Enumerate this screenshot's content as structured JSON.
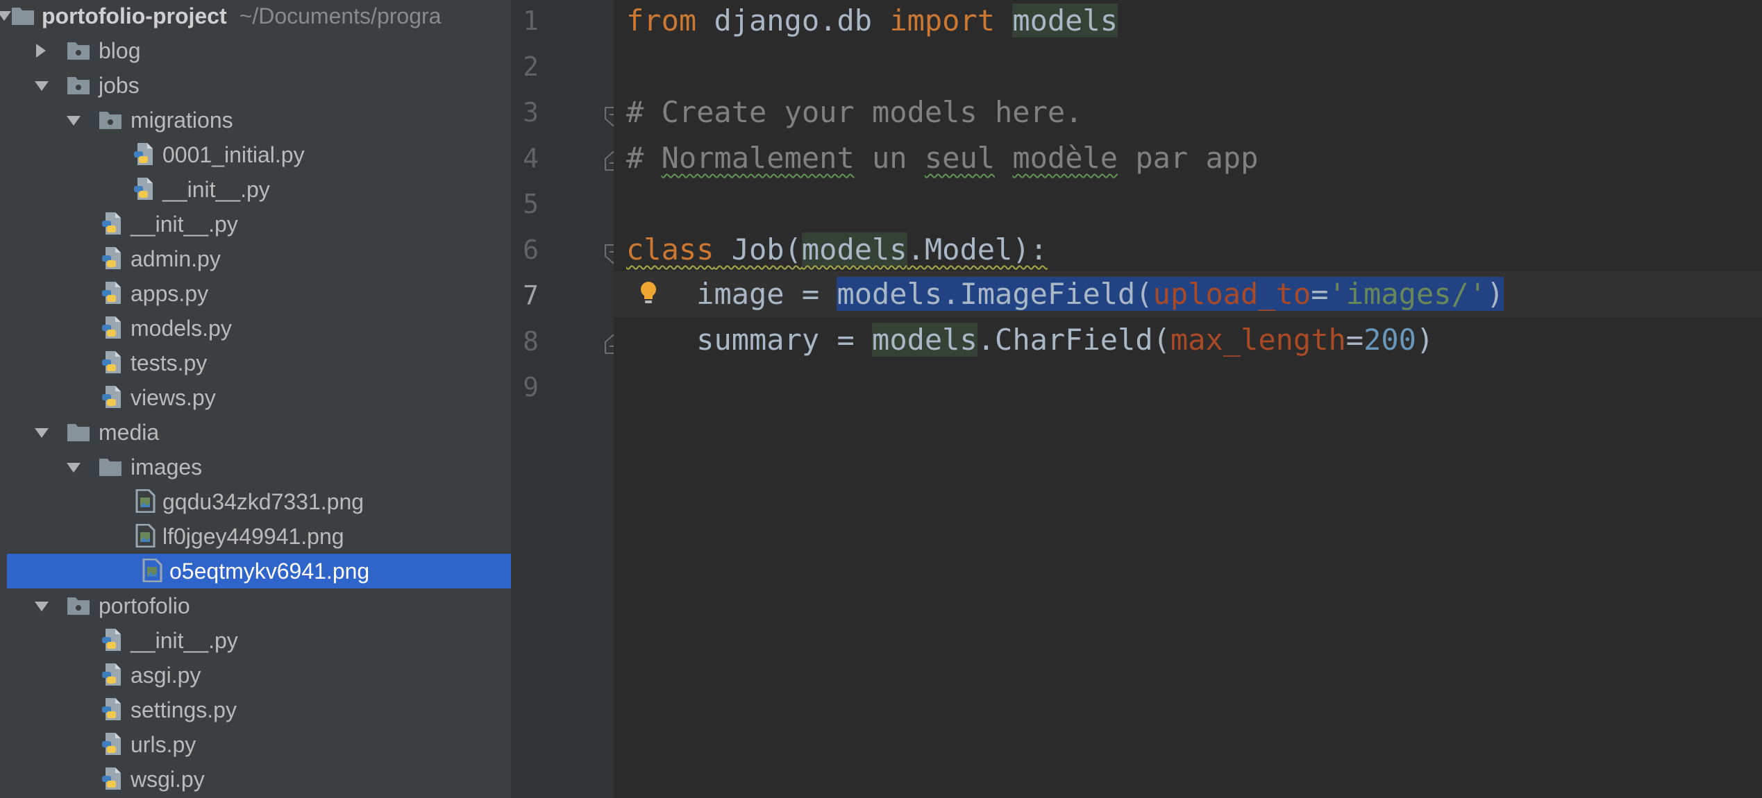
{
  "project_tree": {
    "root": {
      "name": "portofolio-project",
      "path": "~/Documents/progra"
    },
    "items": [
      {
        "label": "blog"
      },
      {
        "label": "jobs"
      },
      {
        "label": "migrations"
      },
      {
        "label": "0001_initial.py"
      },
      {
        "label": "__init__.py"
      },
      {
        "label": "__init__.py"
      },
      {
        "label": "admin.py"
      },
      {
        "label": "apps.py"
      },
      {
        "label": "models.py"
      },
      {
        "label": "tests.py"
      },
      {
        "label": "views.py"
      },
      {
        "label": "media"
      },
      {
        "label": "images"
      },
      {
        "label": "gqdu34zkd7331.png"
      },
      {
        "label": "lf0jgey449941.png"
      },
      {
        "label": "o5eqtmykv6941.png"
      },
      {
        "label": "portofolio"
      },
      {
        "label": "__init__.py"
      },
      {
        "label": "asgi.py"
      },
      {
        "label": "settings.py"
      },
      {
        "label": "urls.py"
      },
      {
        "label": "wsgi.py"
      }
    ],
    "selected_item": "o5eqtmykv6941.png"
  },
  "gutter": {
    "line_numbers": [
      "1",
      "2",
      "3",
      "4",
      "5",
      "6",
      "7",
      "8",
      "9"
    ],
    "current_line": "7"
  },
  "editor": {
    "line1": {
      "kw_from": "from",
      "module": " django.db ",
      "kw_import": "import",
      "sp": " ",
      "name": "models"
    },
    "line3": {
      "comment": "# Create your models here."
    },
    "line4": {
      "hash": "# ",
      "w1": "Normalement",
      "s1": " un ",
      "w2": "seul",
      "s2": " ",
      "w3": "modèle",
      "s3": " par app"
    },
    "line6": {
      "kw_class": "class",
      "s1": " Job(",
      "models": "models",
      "rest": ".Model):"
    },
    "line7": {
      "indent": "    ",
      "target": "image",
      "eq": " = ",
      "call": "models.ImageField(",
      "kwarg": "upload_to",
      "assign": "=",
      "str": "'images/'",
      "close": ")"
    },
    "line8": {
      "indent": "    ",
      "target": "summary",
      "eq": " = ",
      "models": "models",
      "call": ".CharField(",
      "kwarg": "max_length",
      "assign": "=",
      "num": "200",
      "close": ")"
    }
  },
  "colors": {
    "sidebar_bg": "#3c3f41",
    "editor_bg": "#2b2b2b",
    "selection": "#2f65ca",
    "keyword": "#cc7832",
    "string": "#6a8759",
    "number": "#6897bb",
    "comment": "#808080"
  }
}
